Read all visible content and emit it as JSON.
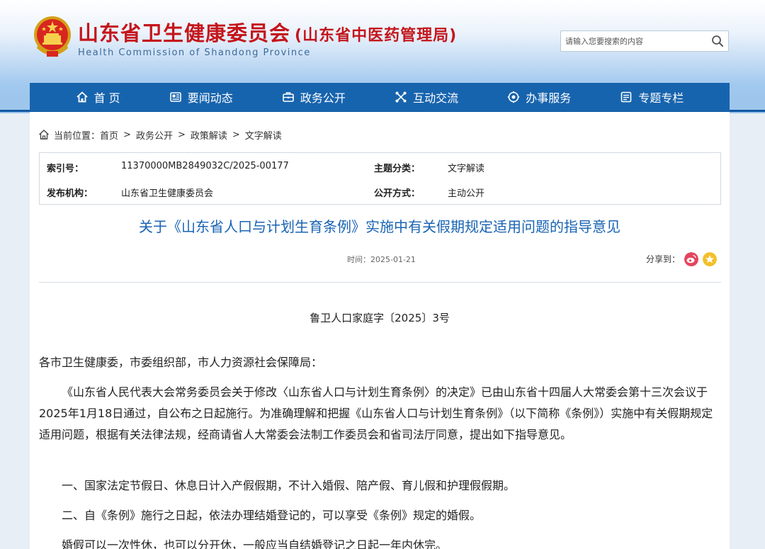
{
  "header": {
    "title": "山东省卫生健康委员会",
    "subtitle": "(山东省中医药管理局)",
    "english": "Health Commission of Shandong Province",
    "search_placeholder": "请输入您要搜索的内容",
    "emblem_icon": "national-emblem-icon"
  },
  "nav": {
    "items": [
      {
        "label": "首 页",
        "icon": "home-icon"
      },
      {
        "label": "要闻动态",
        "icon": "news-icon"
      },
      {
        "label": "政务公开",
        "icon": "briefcase-icon"
      },
      {
        "label": "互动交流",
        "icon": "interaction-icon"
      },
      {
        "label": "办事服务",
        "icon": "service-icon"
      },
      {
        "label": "专题专栏",
        "icon": "topic-icon"
      }
    ]
  },
  "breadcrumb": {
    "prefix": "当前位置：",
    "items": [
      "首页",
      "政务公开",
      "政策解读",
      "文字解读"
    ]
  },
  "meta": {
    "index_label": "索引号：",
    "index_value": "11370000MB2849032C/2025-00177",
    "topic_label": "主题分类：",
    "topic_value": "文字解读",
    "publisher_label": "发布机构：",
    "publisher_value": "山东省卫生健康委员会",
    "disclosure_label": "公开方式：",
    "disclosure_value": "主动公开"
  },
  "article": {
    "title": "关于《山东省人口与计划生育条例》实施中有关假期规定适用问题的指导意见",
    "time": "时间：2025-01-21",
    "share_label": "分享到：",
    "doc_number": "鲁卫人口家庭字〔2025〕3号",
    "paragraphs": [
      "各市卫生健康委，市委组织部，市人力资源社会保障局：",
      "《山东省人民代表大会常务委员会关于修改〈山东省人口与计划生育条例〉的决定》已由山东省十四届人大常委会第十三次会议于2025年1月18日通过，自公布之日起施行。为准确理解和把握《山东省人口与计划生育条例》（以下简称《条例》）实施中有关假期规定适用问题，根据有关法律法规，经商请省人大常委会法制工作委员会和省司法厅同意，提出如下指导意见。",
      "一、国家法定节假日、休息日计入产假假期，不计入婚假、陪产假、育儿假和护理假假期。",
      "二、自《条例》施行之日起，依法办理结婚登记的，可以享受《条例》规定的婚假。",
      "婚假可以一次性休，也可以分开休，一般应当自结婚登记之日起一年内休完。"
    ]
  },
  "colors": {
    "nav_bg": "#1764ae",
    "title_red": "#c4161c",
    "article_title_blue": "#1863b3"
  }
}
